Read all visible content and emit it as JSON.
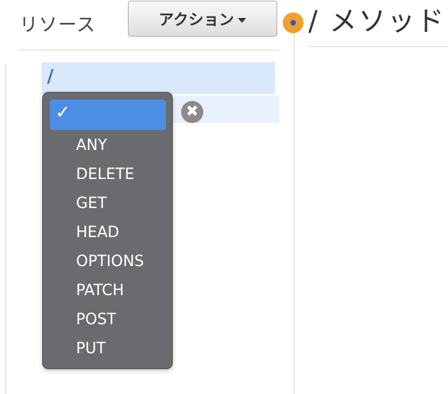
{
  "resources": {
    "title": "リソース"
  },
  "toolbar": {
    "actions_label": "アクション"
  },
  "methods_panel": {
    "title": "/ メソッド"
  },
  "tree": {
    "root_label": "/"
  },
  "method_menu": {
    "selected_mark": "✓",
    "options": [
      "ANY",
      "DELETE",
      "GET",
      "HEAD",
      "OPTIONS",
      "PATCH",
      "POST",
      "PUT"
    ]
  },
  "icons": {
    "clear": "✖"
  },
  "colors": {
    "selection_blue": "#4d8ee4",
    "menu_bg": "#6a6b6e",
    "status_orange": "#f0a030",
    "row_highlight": "#d9e8fb"
  }
}
